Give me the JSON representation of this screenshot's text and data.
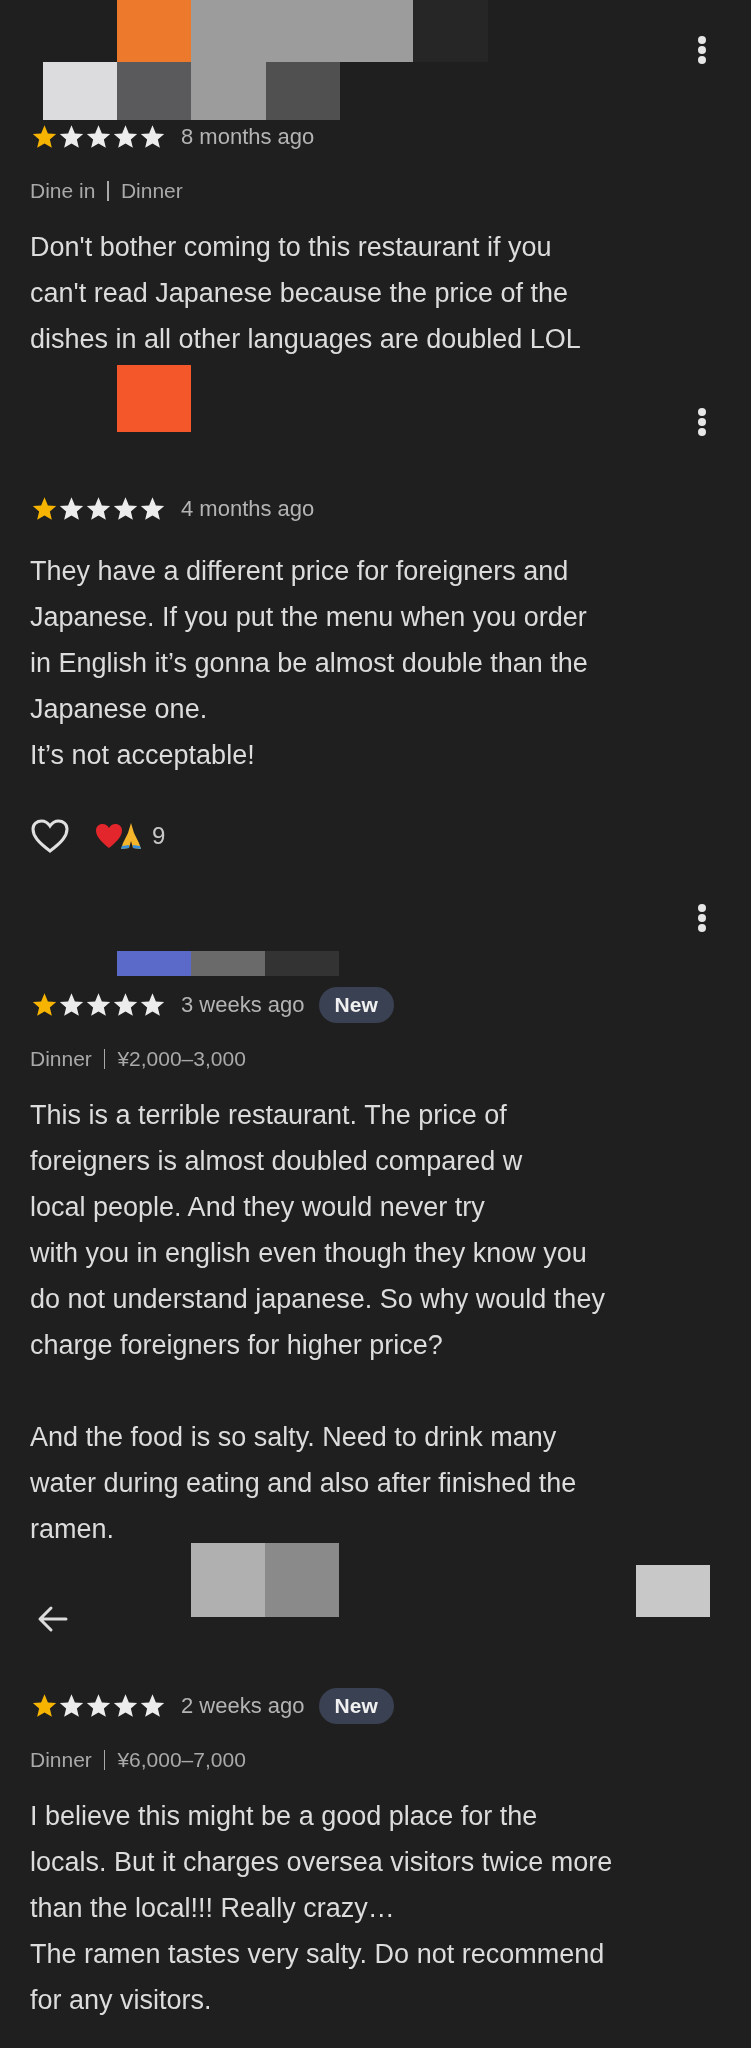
{
  "items": [
    {
      "kind": "review",
      "menu": true,
      "stars": 1,
      "date": "8 months ago",
      "meta": [
        "Dine in",
        "Dinner"
      ],
      "paragraphs": [
        [
          "Don't bother coming to this restaurant if you",
          "can't read Japanese because the price of the",
          "dishes in all other languages are doubled LOL"
        ]
      ]
    },
    {
      "kind": "review",
      "menu": true,
      "stars": 1,
      "date": "4 months ago",
      "paragraphs": [
        [
          "They have a different price for foreigners and",
          "Japanese. If you put the menu when you order",
          "in English it’s gonna be almost double than the",
          "Japanese one.",
          "It’s not acceptable!"
        ]
      ],
      "reactions": {
        "liked": false,
        "count": "9"
      }
    },
    {
      "kind": "review",
      "menu": true,
      "stars": 1,
      "date": "3 weeks ago",
      "badge": "New",
      "meta": [
        "Dinner",
        "¥2,000–3,000"
      ],
      "paragraphs": [
        [
          "This is a terrible restaurant. The price of",
          "foreigners is almost doubled compared w",
          "local people. And they would never try",
          "with you in english even though they know you",
          "do not understand japanese. So why would they",
          "charge foreigners for higher price?"
        ],
        [
          "And the food is so salty. Need to drink many",
          "water during eating and also after finished the",
          "ramen."
        ]
      ]
    },
    {
      "kind": "back"
    },
    {
      "kind": "review",
      "menu": false,
      "stars": 1,
      "date": "2 weeks ago",
      "badge": "New",
      "meta": [
        "Dinner",
        "¥6,000–7,000"
      ],
      "paragraphs": [
        [
          "I believe this might be a good place for the",
          "locals. But it charges oversea visitors twice more",
          "than the local!!! Really crazy…",
          "The ramen tastes very salty. Do not recommend",
          "for any visitors."
        ]
      ]
    }
  ]
}
